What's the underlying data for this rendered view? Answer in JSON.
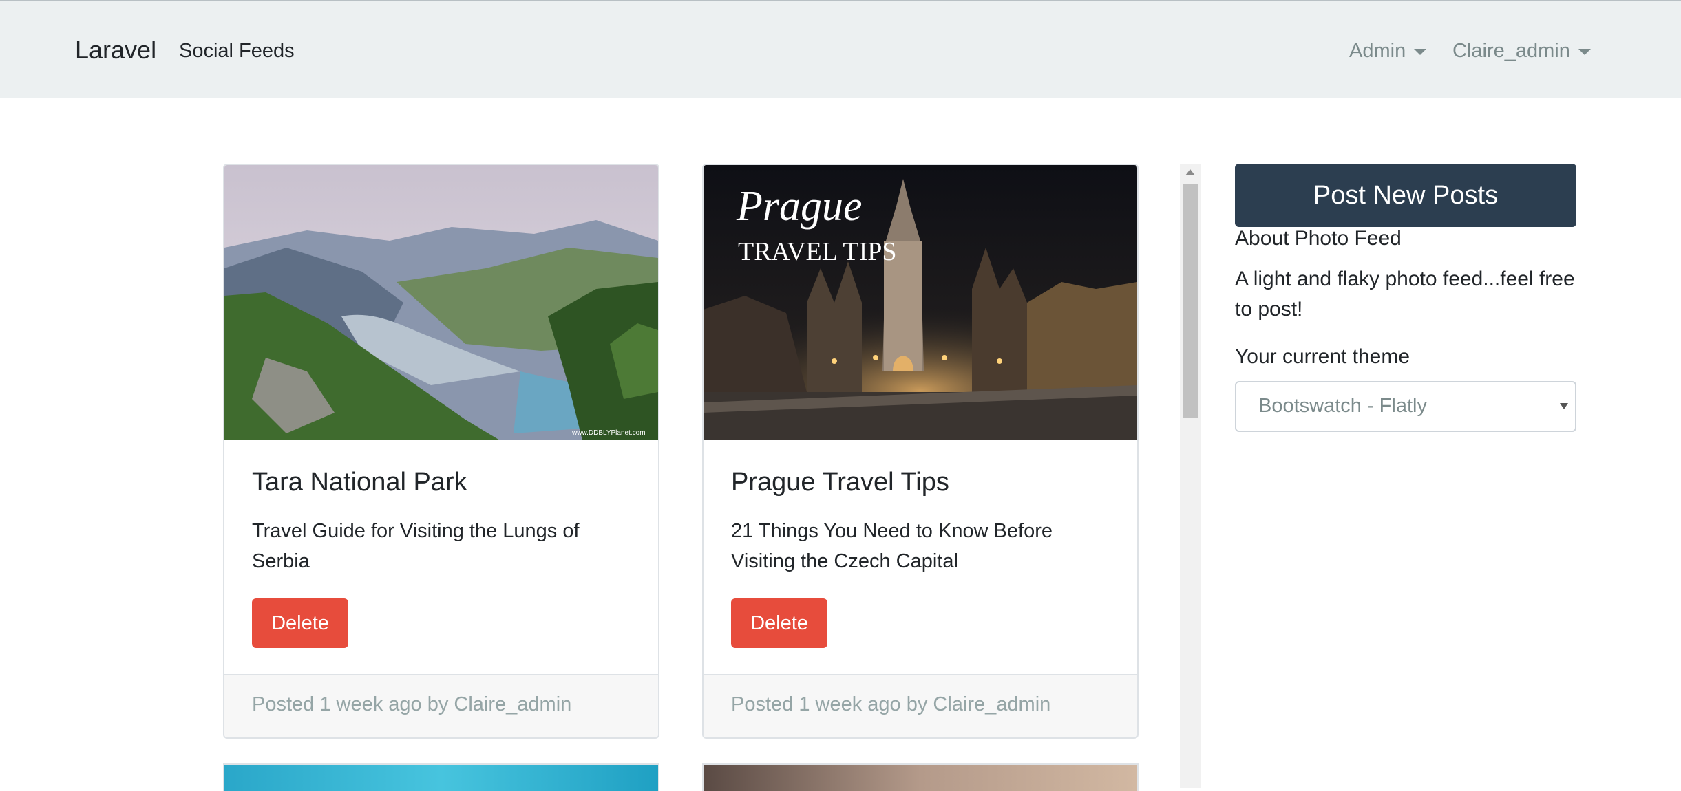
{
  "navbar": {
    "brand": "Laravel",
    "links": [
      "Social Feeds"
    ],
    "admin_menu": "Admin",
    "user_menu": "Claire_admin"
  },
  "posts": [
    {
      "title": "Tara National Park",
      "description": "Travel Guide for Visiting the Lungs of Serbia",
      "delete_label": "Delete",
      "footer": "Posted 1 week ago by Claire_admin",
      "image_watermark": "www.DDBLYPlanet.com"
    },
    {
      "title": "Prague Travel Tips",
      "description": "21 Things You Need to Know Before Visiting the Czech Capital",
      "delete_label": "Delete",
      "footer": "Posted 1 week ago by Claire_admin",
      "image_text_1": "Prague",
      "image_text_2": "TRAVEL TIPS"
    }
  ],
  "sidebar": {
    "post_button": "Post New Posts",
    "about_title": "About Photo Feed",
    "about_text": "A light and flaky photo feed...feel free to post!",
    "theme_label": "Your current theme",
    "theme_value": "Bootswatch - Flatly"
  },
  "colors": {
    "navbar_bg": "#ecf0f1",
    "primary": "#2c3e50",
    "danger": "#e74c3c",
    "muted": "#95a5a6"
  }
}
